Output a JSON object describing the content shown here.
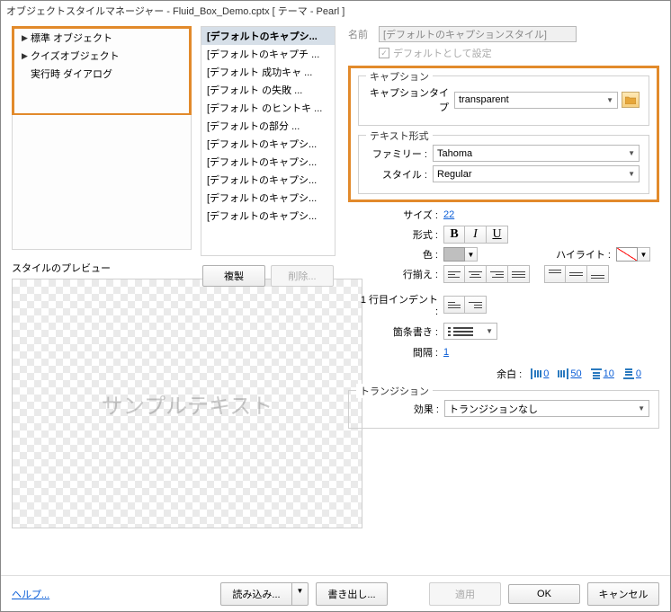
{
  "title": "オブジェクトスタイルマネージャー - Fluid_Box_Demo.cptx [ テーマ - Pearl ]",
  "tree": {
    "items": [
      {
        "label": "標準 オブジェクト"
      },
      {
        "label": "クイズオブジェクト"
      },
      {
        "label": "実行時 ダイアログ"
      }
    ]
  },
  "list": {
    "items": [
      "[デフォルトのキャプシ...",
      "[デフォルトのキャプチ ...",
      "[デフォルト 成功キャ ...",
      "[デフォルト の失敗 ...",
      "[デフォルト のヒントキ ...",
      "[デフォルトの部分 ...",
      "[デフォルトのキャプシ...",
      "[デフォルトのキャプシ...",
      "[デフォルトのキャプシ...",
      "[デフォルトのキャプシ...",
      "[デフォルトのキャプシ..."
    ]
  },
  "buttons": {
    "dup": "複製",
    "del": "削除..."
  },
  "right": {
    "nameLabel": "名前",
    "nameValue": "[デフォルトのキャプションスタイル]",
    "setDefault": "デフォルトとして設定",
    "caption": {
      "groupTitle": "キャプション",
      "typeLabel": "キャプションタイプ",
      "typeValue": "transparent"
    },
    "text": {
      "groupTitle": "テキスト形式",
      "familyLabel": "ファミリー :",
      "familyValue": "Tahoma",
      "styleLabel": "スタイル :",
      "styleValue": "Regular",
      "sizeLabel": "サイズ :",
      "sizeValue": "22",
      "formatLabel": "形式 :",
      "colorLabel": "色 :",
      "highlightLabel": "ハイライト :",
      "alignLabel": "行揃え :",
      "indentLabel": "1 行目インデント :",
      "bulletLabel": "箇条書き :",
      "spacingLabel": "間隔 :",
      "spacingValue": "1",
      "marginLabel": "余白 :",
      "margins": {
        "left": "0",
        "right": "50",
        "top": "10",
        "bottom": "0"
      }
    },
    "transition": {
      "groupTitle": "トランジション",
      "effectLabel": "効果 :",
      "effectValue": "トランジションなし"
    }
  },
  "preview": {
    "label": "スタイルのプレビュー",
    "sample": "サンプルテキスト"
  },
  "footer": {
    "help": "ヘルプ...",
    "import": "読み込み...",
    "export": "書き出し...",
    "apply": "適用",
    "ok": "OK",
    "cancel": "キャンセル"
  }
}
